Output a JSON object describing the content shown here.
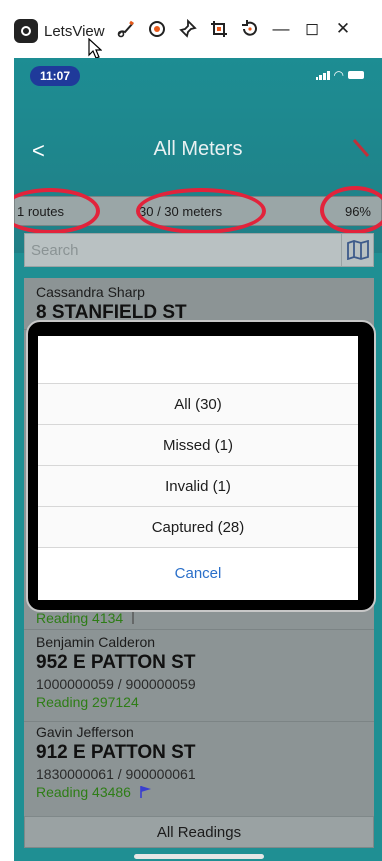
{
  "app": {
    "title": "LetsView",
    "window_controls": [
      "brush-icon",
      "record-icon",
      "pin-icon",
      "crop-icon",
      "rotate-icon",
      "minimize-icon",
      "maximize-icon",
      "close-icon"
    ],
    "minimize_glyph": "—",
    "maximize_glyph": "◻",
    "close_glyph": "✕"
  },
  "status_bar": {
    "time": "11:07"
  },
  "header": {
    "back_glyph": "<",
    "title": "All Meters"
  },
  "summary": {
    "routes": "1 routes",
    "meters": "30 / 30 meters",
    "percent": "96%"
  },
  "search": {
    "placeholder": "Search"
  },
  "meters": [
    {
      "customer": "Cassandra Sharp",
      "address": "8 STANFIELD ST",
      "ids": "",
      "reading": ""
    },
    {
      "customer": "",
      "address": "",
      "ids": "",
      "reading": "Reading 4134"
    },
    {
      "customer": "Benjamin Calderon",
      "address": "952 E PATTON ST",
      "ids": "1000000059 / 900000059",
      "reading": "Reading 297124"
    },
    {
      "customer": "Gavin Jefferson",
      "address": "912 E PATTON ST",
      "ids": "1830000061 / 900000061",
      "reading": "Reading 43486"
    }
  ],
  "filter_sheet": {
    "options": [
      "All (30)",
      "Missed (1)",
      "Invalid (1)",
      "Captured (28)"
    ],
    "cancel": "Cancel"
  },
  "bottom_button": "All Readings",
  "colors": {
    "accent": "#1f8f93",
    "highlight": "#e2233b",
    "cancel": "#2a6fc9",
    "reading": "#2e7d16",
    "flag": "#3a3fd0"
  }
}
